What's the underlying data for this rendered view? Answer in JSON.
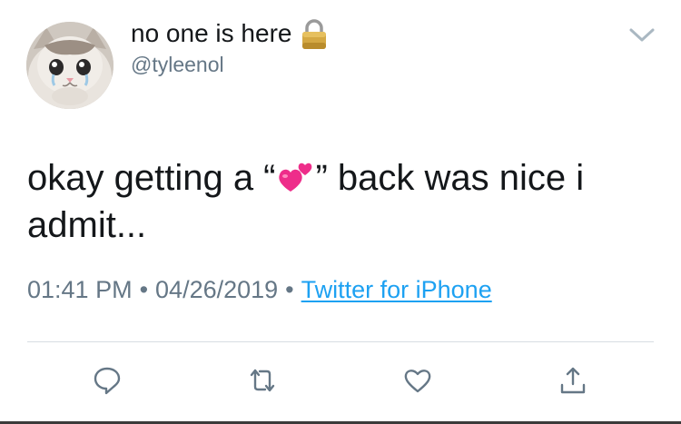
{
  "user": {
    "display_name": "no one is here",
    "handle": "@tyleenol",
    "protected_icon": "lock-icon",
    "avatar": "crying-cat-avatar"
  },
  "tweet": {
    "text_before_emoji": "okay getting a “",
    "emoji": "two-hearts-emoji",
    "text_after_emoji": "” back was nice i admit...",
    "time": "01:41 PM",
    "separator": "•",
    "date": "04/26/2019",
    "source": "Twitter for iPhone"
  },
  "actions": [
    {
      "name": "reply-icon"
    },
    {
      "name": "retweet-icon"
    },
    {
      "name": "like-icon"
    },
    {
      "name": "share-icon"
    }
  ],
  "colors": {
    "text": "#14171a",
    "secondary": "#657786",
    "link": "#1da1f2",
    "divider": "#d8dde2"
  }
}
